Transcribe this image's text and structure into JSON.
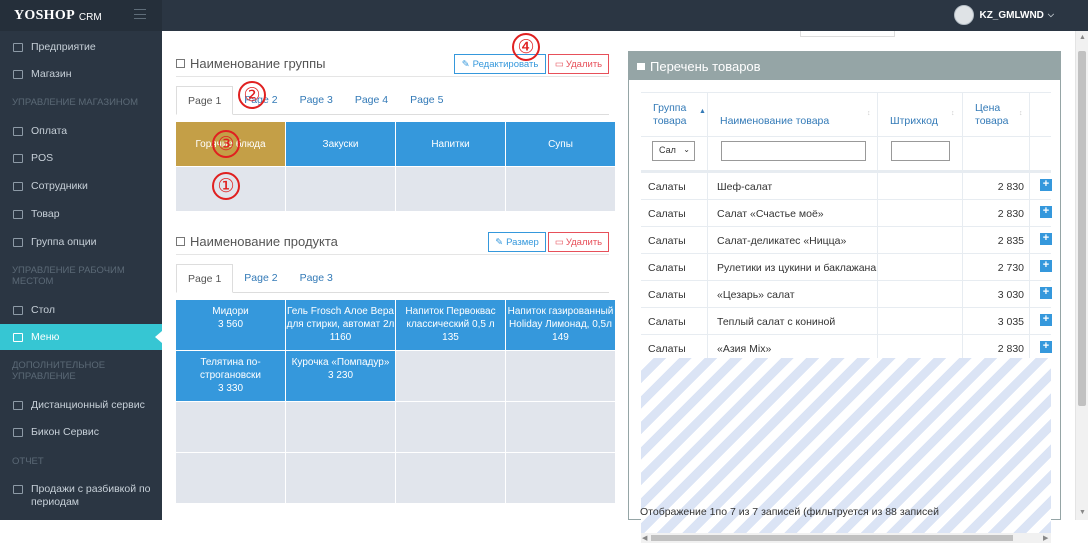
{
  "app": {
    "logo": "YOSHOP",
    "logo_suffix": "CRM",
    "user": "KZ_GMLWND"
  },
  "sidebar": {
    "items": [
      {
        "label": "Предприятие",
        "icon": "shield-icon"
      },
      {
        "label": "Магазин",
        "icon": "store-icon"
      },
      {
        "label": "Оплата",
        "icon": "card-icon"
      },
      {
        "label": "POS",
        "icon": "pos-icon"
      },
      {
        "label": "Сотрудники",
        "icon": "users-icon"
      },
      {
        "label": "Товар",
        "icon": "cart-icon"
      },
      {
        "label": "Группа опции",
        "icon": "cart-icon"
      },
      {
        "label": "Стол",
        "icon": "table-icon"
      },
      {
        "label": "Меню",
        "icon": "book-icon"
      },
      {
        "label": "Дистанционный сервис",
        "icon": "globe-icon"
      },
      {
        "label": "Бикон Сервис",
        "icon": "pin-icon"
      },
      {
        "label": "Продажи с разбивкой по периодам",
        "icon": "grid-icon"
      }
    ],
    "headings": [
      "УПРАВЛЕНИЕ МАГАЗИНОМ",
      "УПРАВЛЕНИЕ РАБОЧИМ МЕСТОМ",
      "ДОПОЛНИТЕЛЬНОЕ УПРАВЛЕНИЕ",
      "ОТЧЕТ"
    ]
  },
  "groups": {
    "title": "Наименование группы",
    "edit_label": "Редактировать",
    "delete_label": "Удалить",
    "tabs": [
      "Page 1",
      "Page 2",
      "Page 3",
      "Page 4",
      "Page 5"
    ],
    "cells": [
      "Горячие блюда",
      "Закуски",
      "Напитки",
      "Супы"
    ]
  },
  "products": {
    "title": "Наименование продукта",
    "size_label": "Размер",
    "delete_label": "Удалить",
    "tabs": [
      "Page 1",
      "Page 2",
      "Page 3"
    ],
    "cells": [
      {
        "name": "Мидори",
        "price": "3 560"
      },
      {
        "name": "Гель Frosch Алое Вера для стирки, автомат 2л",
        "price": "1160"
      },
      {
        "name": "Напиток Первоквас классический 0,5 л",
        "price": "135"
      },
      {
        "name": "Напиток газированный Holiday Лимонад, 0,5л",
        "price": "149"
      },
      {
        "name": "Телятина по-строгановски",
        "price": "3 330"
      },
      {
        "name": "Курочка «Помпадур»",
        "price": "3 230"
      }
    ]
  },
  "markers": [
    "①",
    "②",
    "③",
    "④"
  ],
  "list": {
    "title": "Перечень товаров",
    "columns": [
      "Группа товара",
      "Наименование товара",
      "Штрихкод",
      "Цена товара"
    ],
    "filter_select": "Сал",
    "rows": [
      {
        "group": "Салаты",
        "name": "Шеф-салат",
        "price": "2 830"
      },
      {
        "group": "Салаты",
        "name": "Салат «Счастье моё»",
        "price": "2 830"
      },
      {
        "group": "Салаты",
        "name": "Салат-деликатес «Ницца»",
        "price": "2 835"
      },
      {
        "group": "Салаты",
        "name": "Рулетики из цукини и баклажана",
        "price": "2 730"
      },
      {
        "group": "Салаты",
        "name": "«Цезарь» салат",
        "price": "3 030"
      },
      {
        "group": "Салаты",
        "name": "Теплый салат с кониной",
        "price": "3 035"
      },
      {
        "group": "Салаты",
        "name": "«Азия Mix»",
        "price": "2 830"
      }
    ],
    "footer": "Отображение 1по 7 из 7 записей (фильтруется из 88 записей"
  }
}
